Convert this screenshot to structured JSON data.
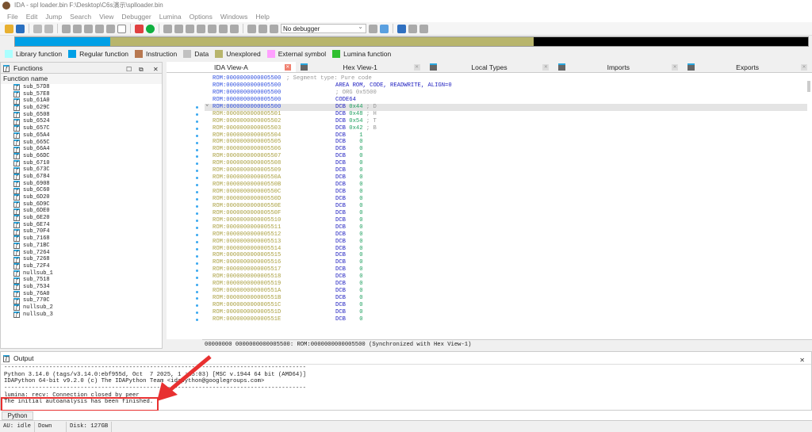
{
  "window": {
    "title": "IDA - spl loader.bin F:\\Desktop\\C6s演示\\splloader.bin"
  },
  "menu": [
    "File",
    "Edit",
    "Jump",
    "Search",
    "View",
    "Debugger",
    "Lumina",
    "Options",
    "Windows",
    "Help"
  ],
  "toolbar": {
    "debugger_select": "No debugger"
  },
  "legend": [
    {
      "label": "Library function",
      "color": "#aaffff"
    },
    {
      "label": "Regular function",
      "color": "#00a0e6"
    },
    {
      "label": "Instruction",
      "color": "#b87850"
    },
    {
      "label": "Data",
      "color": "#c0c0c0"
    },
    {
      "label": "Unexplored",
      "color": "#b8b56c"
    },
    {
      "label": "External symbol",
      "color": "#ffa0ff"
    },
    {
      "label": "Lumina function",
      "color": "#30c030"
    }
  ],
  "functions": {
    "title": "Functions",
    "column": "Function name",
    "items": [
      "sub_57D8",
      "sub_57E8",
      "sub_61A0",
      "sub_629C",
      "sub_6508",
      "sub_6524",
      "sub_657C",
      "sub_65A4",
      "sub_665C",
      "sub_66A4",
      "sub_66DC",
      "sub_6710",
      "sub_673C",
      "sub_6784",
      "sub_6908",
      "sub_6C60",
      "sub_6D20",
      "sub_6D9C",
      "sub_6DE0",
      "sub_6E20",
      "sub_6E74",
      "sub_70F4",
      "sub_7168",
      "sub_71BC",
      "sub_7264",
      "sub_7268",
      "sub_72F4",
      "nullsub_1",
      "sub_7518",
      "sub_7534",
      "sub_76A0",
      "sub_770C",
      "nullsub_2",
      "nullsub_3"
    ]
  },
  "tabs": [
    {
      "label": "IDA View-A",
      "active": true
    },
    {
      "label": "Hex View-1"
    },
    {
      "label": "Local Types"
    },
    {
      "label": "Imports"
    },
    {
      "label": "Exports"
    }
  ],
  "disasm": {
    "lines": [
      {
        "addr": "ROM:0000000000005500",
        "text": "; Segment type: Pure code",
        "kind": "segcmt"
      },
      {
        "addr": "ROM:0000000000005500",
        "op": "AREA ROM, CODE, READWRITE, ALIGN=0",
        "kind": "dir"
      },
      {
        "addr": "ROM:0000000000005500",
        "op": "; ORG 0x5500",
        "kind": "cmt"
      },
      {
        "addr": "ROM:0000000000005500",
        "op": "CODE64",
        "kind": "dir"
      },
      {
        "addr": "ROM:0000000000005500",
        "op": "DCB",
        "val": "0x44",
        "cmt": "; D",
        "kind": "sel"
      },
      {
        "addr": "ROM:0000000000005501",
        "op": "DCB",
        "val": "0x48",
        "cmt": "; H"
      },
      {
        "addr": "ROM:0000000000005502",
        "op": "DCB",
        "val": "0x54",
        "cmt": "; T"
      },
      {
        "addr": "ROM:0000000000005503",
        "op": "DCB",
        "val": "0x42",
        "cmt": "; B"
      },
      {
        "addr": "ROM:0000000000005504",
        "op": "DCB",
        "val": "   1"
      },
      {
        "addr": "ROM:0000000000005505",
        "op": "DCB",
        "val": "   0"
      },
      {
        "addr": "ROM:0000000000005506",
        "op": "DCB",
        "val": "   0"
      },
      {
        "addr": "ROM:0000000000005507",
        "op": "DCB",
        "val": "   0"
      },
      {
        "addr": "ROM:0000000000005508",
        "op": "DCB",
        "val": "   0"
      },
      {
        "addr": "ROM:0000000000005509",
        "op": "DCB",
        "val": "   0"
      },
      {
        "addr": "ROM:000000000000550A",
        "op": "DCB",
        "val": "   0"
      },
      {
        "addr": "ROM:000000000000550B",
        "op": "DCB",
        "val": "   0"
      },
      {
        "addr": "ROM:000000000000550C",
        "op": "DCB",
        "val": "   0"
      },
      {
        "addr": "ROM:000000000000550D",
        "op": "DCB",
        "val": "   0"
      },
      {
        "addr": "ROM:000000000000550E",
        "op": "DCB",
        "val": "   0"
      },
      {
        "addr": "ROM:000000000000550F",
        "op": "DCB",
        "val": "   0"
      },
      {
        "addr": "ROM:0000000000005510",
        "op": "DCB",
        "val": "   0"
      },
      {
        "addr": "ROM:0000000000005511",
        "op": "DCB",
        "val": "   0"
      },
      {
        "addr": "ROM:0000000000005512",
        "op": "DCB",
        "val": "   0"
      },
      {
        "addr": "ROM:0000000000005513",
        "op": "DCB",
        "val": "   0"
      },
      {
        "addr": "ROM:0000000000005514",
        "op": "DCB",
        "val": "   0"
      },
      {
        "addr": "ROM:0000000000005515",
        "op": "DCB",
        "val": "   0"
      },
      {
        "addr": "ROM:0000000000005516",
        "op": "DCB",
        "val": "   0"
      },
      {
        "addr": "ROM:0000000000005517",
        "op": "DCB",
        "val": "   0"
      },
      {
        "addr": "ROM:0000000000005518",
        "op": "DCB",
        "val": "   0"
      },
      {
        "addr": "ROM:0000000000005519",
        "op": "DCB",
        "val": "   0"
      },
      {
        "addr": "ROM:000000000000551A",
        "op": "DCB",
        "val": "   0"
      },
      {
        "addr": "ROM:000000000000551B",
        "op": "DCB",
        "val": "   0"
      },
      {
        "addr": "ROM:000000000000551C",
        "op": "DCB",
        "val": "   0"
      },
      {
        "addr": "ROM:000000000000551D",
        "op": "DCB",
        "val": "   0"
      },
      {
        "addr": "ROM:000000000000551E",
        "op": "DCB",
        "val": "   0"
      }
    ],
    "status": "00000000 0000000000005500: ROM:0000000000005500 (Synchronized with Hex View-1)"
  },
  "output": {
    "title": "Output",
    "lines": [
      "---------------------------------------------------------------------------------------",
      "Python 3.14.0 (tags/v3.14.0:ebf955d, Oct  7 2025, 1 :15:03) [MSC v.1944 64 bit (AMD64)]",
      "IDAPython 64-bit v9.2.0 (c) The IDAPython Team <idapython@googlegroups.com>",
      "---------------------------------------------------------------------------------------",
      "lumina: recv: Connection closed by peer",
      "The initial autoanalysis has been finished."
    ],
    "input_tab": "Python"
  },
  "status": {
    "au": "AU:  idle",
    "dir": "Down",
    "disk": "Disk: 127GB"
  },
  "annotation": {
    "highlight_color": "#e83030"
  }
}
